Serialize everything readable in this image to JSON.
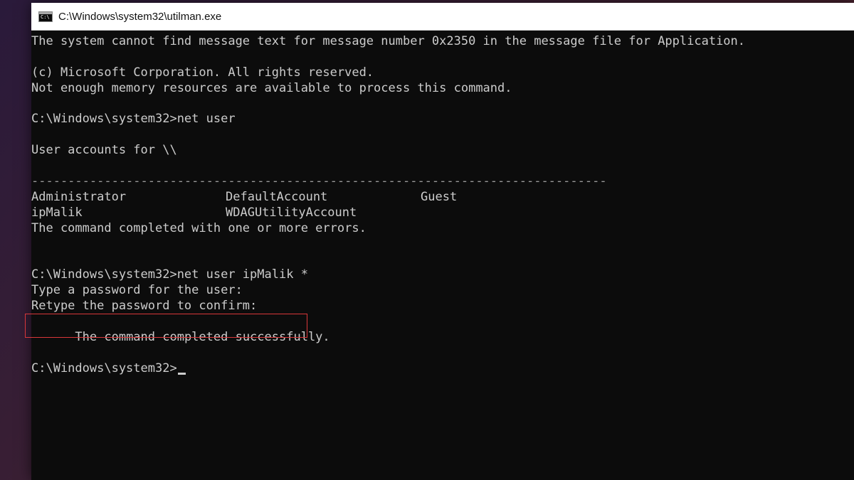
{
  "window": {
    "title": "C:\\Windows\\system32\\utilman.exe",
    "icon": "console-icon",
    "icon_label": "C:\\"
  },
  "console": {
    "line1": "The system cannot find message text for message number 0x2350 in the message file for Application.",
    "line2": "(c) Microsoft Corporation. All rights reserved.",
    "line3": "Not enough memory resources are available to process this command.",
    "prompt1": "C:\\Windows\\system32>net user",
    "accounts_header": "User accounts for \\\\",
    "separator": "-------------------------------------------------------------------------------",
    "accounts": [
      [
        "Administrator",
        "DefaultAccount",
        "Guest"
      ],
      [
        "ipMalik",
        "WDAGUtilityAccount",
        ""
      ]
    ],
    "status1": "The command completed with one or more errors.",
    "prompt2": "C:\\Windows\\system32>net user ipMalik *",
    "pw1": "Type a password for the user:",
    "pw2": "Retype the password to confirm:",
    "success": "The command completed successfully.",
    "prompt3": "C:\\Windows\\system32>"
  },
  "colors": {
    "console_bg": "#0c0c0c",
    "console_text": "#cccccc",
    "highlight_border": "#d9373a"
  }
}
